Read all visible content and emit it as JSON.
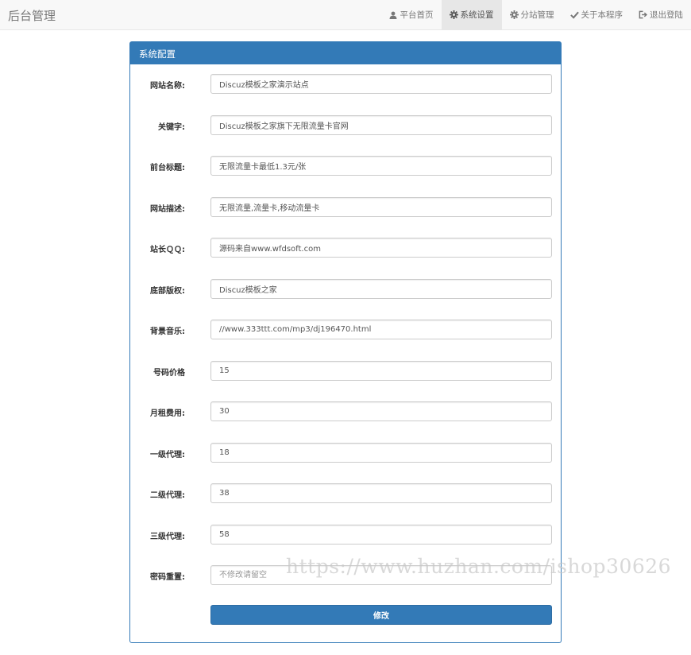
{
  "navbar": {
    "brand": "后台管理",
    "items": [
      {
        "label": "平台首页",
        "icon": "user-icon"
      },
      {
        "label": "系统设置",
        "icon": "gear-icon"
      },
      {
        "label": "分站管理",
        "icon": "gear-icon"
      },
      {
        "label": "关于本程序",
        "icon": "check-icon"
      },
      {
        "label": "退出登陆",
        "icon": "logout-icon"
      }
    ],
    "active_item": "系统设置"
  },
  "panel": {
    "title": "系统配置",
    "fields": [
      {
        "label": "网站名称:",
        "value": "Discuz模板之家演示站点",
        "placeholder": ""
      },
      {
        "label": "关键字:",
        "value": "Discuz模板之家旗下无限流量卡官网",
        "placeholder": ""
      },
      {
        "label": "前台标题:",
        "value": "无限流量卡最低1.3元/张",
        "placeholder": ""
      },
      {
        "label": "网站描述:",
        "value": "无限流量,流量卡,移动流量卡",
        "placeholder": ""
      },
      {
        "label": "站长ＱＱ:",
        "value": "源码来自www.wfdsoft.com",
        "placeholder": ""
      },
      {
        "label": "底部版权:",
        "value": "Discuz模板之家",
        "placeholder": ""
      },
      {
        "label": "背景音乐:",
        "value": "//www.333ttt.com/mp3/dj196470.html",
        "placeholder": ""
      },
      {
        "label": "号码价格",
        "value": "15",
        "placeholder": ""
      },
      {
        "label": "月租费用:",
        "value": "30",
        "placeholder": ""
      },
      {
        "label": "一级代理:",
        "value": "18",
        "placeholder": ""
      },
      {
        "label": "二级代理:",
        "value": "38",
        "placeholder": ""
      },
      {
        "label": "三级代理:",
        "value": "58",
        "placeholder": ""
      },
      {
        "label": "密码重置:",
        "value": "",
        "placeholder": "不修改请留空"
      }
    ],
    "submit_label": "修改"
  },
  "watermark": "https://www.huzhan.com/ishop30626",
  "colors": {
    "primary": "#337ab7",
    "navbar_bg": "#f8f8f8",
    "active_nav_bg": "#e7e7e7"
  }
}
